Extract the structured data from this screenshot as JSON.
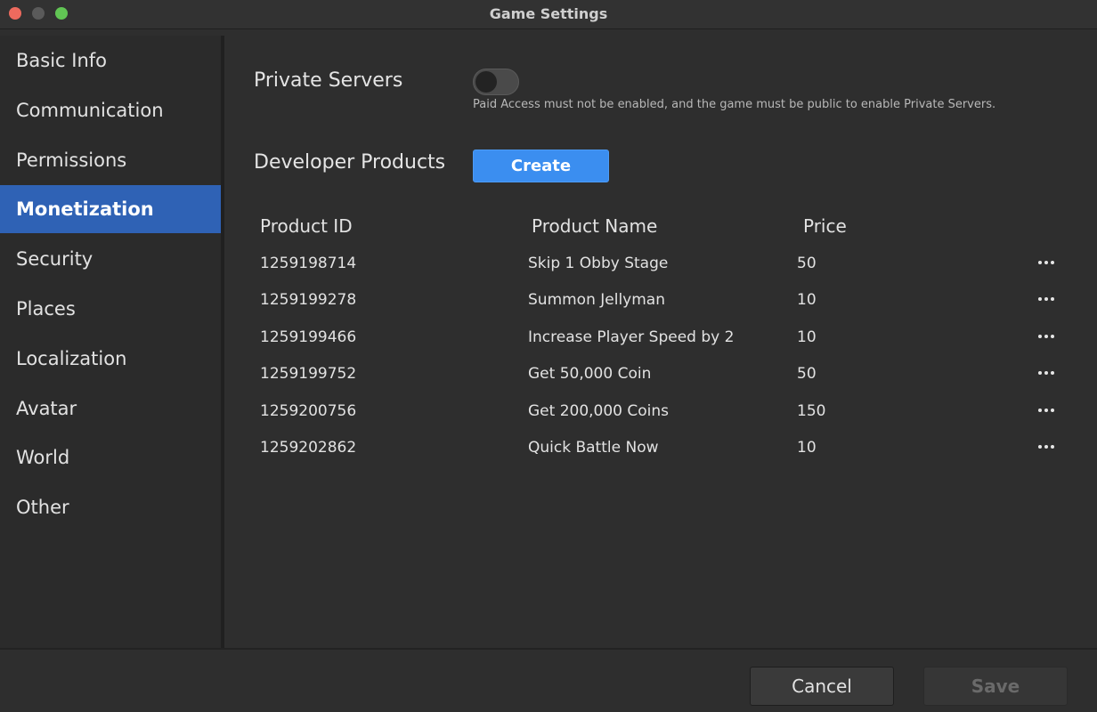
{
  "window": {
    "title": "Game Settings"
  },
  "sidebar": {
    "items": [
      {
        "label": "Basic Info"
      },
      {
        "label": "Communication"
      },
      {
        "label": "Permissions"
      },
      {
        "label": "Monetization",
        "active": true
      },
      {
        "label": "Security"
      },
      {
        "label": "Places"
      },
      {
        "label": "Localization"
      },
      {
        "label": "Avatar"
      },
      {
        "label": "World"
      },
      {
        "label": "Other"
      }
    ]
  },
  "private_servers": {
    "label": "Private Servers",
    "enabled": false,
    "hint": "Paid Access must not be enabled, and the game must be public to enable Private Servers."
  },
  "developer_products": {
    "label": "Developer Products",
    "create_label": "Create",
    "columns": {
      "id": "Product ID",
      "name": "Product Name",
      "price": "Price"
    },
    "rows": [
      {
        "id": "1259198714",
        "name": "Skip 1 Obby Stage",
        "price": "50"
      },
      {
        "id": "1259199278",
        "name": "Summon Jellyman",
        "price": "10"
      },
      {
        "id": "1259199466",
        "name": "Increase Player Speed by 2",
        "price": "10"
      },
      {
        "id": "1259199752",
        "name": "Get 50,000 Coin",
        "price": "50"
      },
      {
        "id": "1259200756",
        "name": "Get 200,000 Coins",
        "price": "150"
      },
      {
        "id": "1259202862",
        "name": "Quick Battle Now",
        "price": "10"
      }
    ]
  },
  "footer": {
    "cancel_label": "Cancel",
    "save_label": "Save"
  },
  "colors": {
    "accent": "#3b8ef0",
    "sidebar_active": "#2f62b5"
  }
}
